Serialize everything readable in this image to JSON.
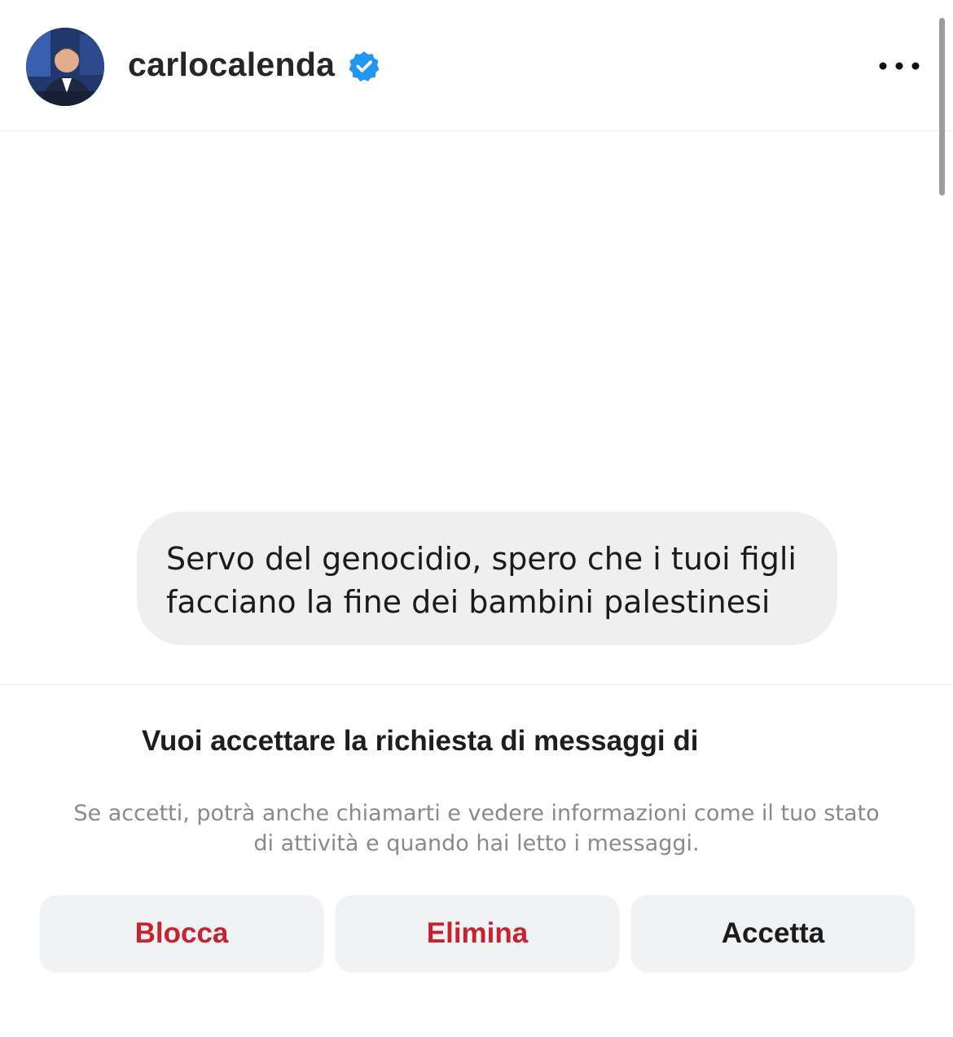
{
  "header": {
    "username": "carlocalenda",
    "verified_icon": "verified-badge-icon",
    "more_icon": "more-options-icon",
    "verified_color": "#2196f3"
  },
  "message": {
    "lines": [
      "Servo del genocidio, spero che i tuoi figli",
      "facciano la fine dei bambini palestinesi"
    ]
  },
  "request": {
    "question": "Vuoi accettare la richiesta di messaggi di",
    "info_lines": [
      "Se accetti, potrà anche chiamarti e vedere informazioni come il tuo stato",
      "di attività e quando hai letto i messaggi."
    ]
  },
  "actions": {
    "block_label": "Blocca",
    "delete_label": "Elimina",
    "accept_label": "Accetta",
    "danger_color": "#c62230"
  }
}
